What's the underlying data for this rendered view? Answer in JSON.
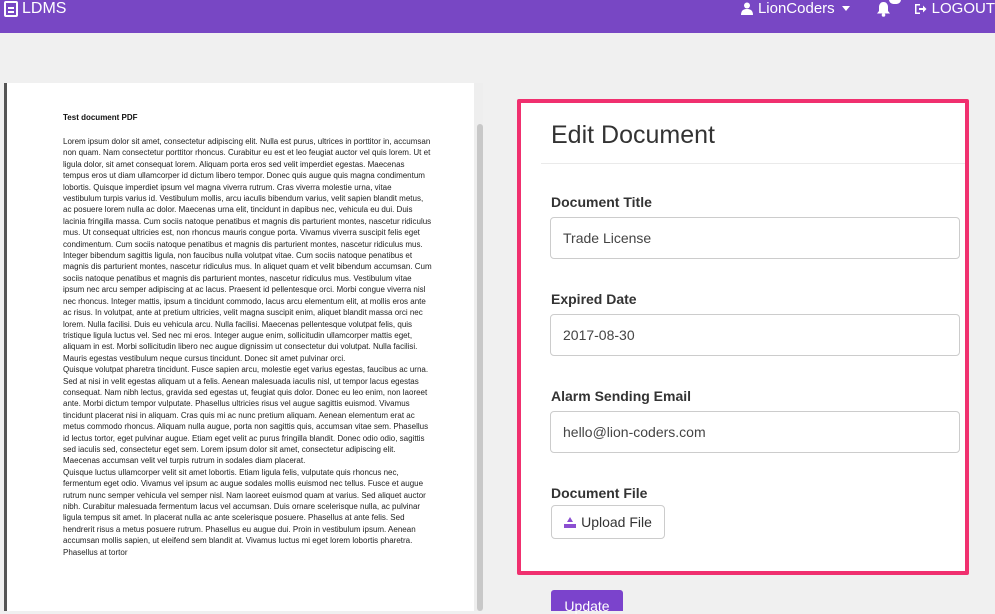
{
  "topbar": {
    "brand": "LDMS",
    "user_name": "LionCoders",
    "logout_label": "LOGOUT"
  },
  "viewer": {
    "doc_title": "Test document PDF",
    "doc_text": "Lorem ipsum dolor sit amet, consectetur adipiscing elit. Nulla est purus, ultrices in porttitor in, accumsan non quam. Nam consectetur porttitor rhoncus. Curabitur eu est et leo feugiat auctor vel quis lorem. Ut et ligula dolor, sit amet consequat lorem. Aliquam porta eros sed velit imperdiet egestas. Maecenas tempus eros ut diam ullamcorper id dictum libero tempor. Donec quis augue quis magna condimentum lobortis. Quisque imperdiet ipsum vel magna viverra rutrum. Cras viverra molestie urna, vitae vestibulum turpis varius id. Vestibulum mollis, arcu iaculis bibendum varius, velit sapien blandit metus, ac posuere lorem nulla ac dolor. Maecenas urna elit, tincidunt in dapibus nec, vehicula eu dui. Duis lacinia fringilla massa. Cum sociis natoque penatibus et magnis dis parturient montes, nascetur ridiculus mus. Ut consequat ultricies est, non rhoncus mauris congue porta. Vivamus viverra suscipit felis eget condimentum. Cum sociis natoque penatibus et magnis dis parturient montes, nascetur ridiculus mus. Integer bibendum sagittis ligula, non faucibus nulla volutpat vitae. Cum sociis natoque penatibus et magnis dis parturient montes, nascetur ridiculus mus. In aliquet quam et velit bibendum accumsan. Cum sociis natoque penatibus et magnis dis parturient montes, nascetur ridiculus mus. Vestibulum vitae ipsum nec arcu semper adipiscing at ac lacus. Praesent id pellentesque orci. Morbi congue viverra nisl nec rhoncus. Integer mattis, ipsum a tincidunt commodo, lacus arcu elementum elit, at mollis eros ante ac risus. In volutpat, ante at pretium ultricies, velit magna suscipit enim, aliquet blandit massa orci nec lorem. Nulla facilisi. Duis eu vehicula arcu. Nulla facilisi. Maecenas pellentesque volutpat felis, quis tristique ligula luctus vel. Sed nec mi eros. Integer augue enim, sollicitudin ullamcorper mattis eget, aliquam in est. Morbi sollicitudin libero nec augue dignissim ut consectetur dui volutpat. Nulla facilisi. Mauris egestas vestibulum neque cursus tincidunt. Donec sit amet pulvinar orci.\nQuisque volutpat pharetra tincidunt. Fusce sapien arcu, molestie eget varius egestas, faucibus ac urna. Sed at nisi in velit egestas aliquam ut a felis. Aenean malesuada iaculis nisl, ut tempor lacus egestas consequat. Nam nibh lectus, gravida sed egestas ut, feugiat quis dolor. Donec eu leo enim, non laoreet ante. Morbi dictum tempor vulputate. Phasellus ultricies risus vel augue sagittis euismod. Vivamus tincidunt placerat nisi in aliquam. Cras quis mi ac nunc pretium aliquam. Aenean elementum erat ac metus commodo rhoncus. Aliquam nulla augue, porta non sagittis quis, accumsan vitae sem. Phasellus id lectus tortor, eget pulvinar augue. Etiam eget velit ac purus fringilla blandit. Donec odio odio, sagittis sed iaculis sed, consectetur eget sem. Lorem ipsum dolor sit amet, consectetur adipiscing elit. Maecenas accumsan velit vel turpis rutrum in sodales diam placerat.\nQuisque luctus ullamcorper velit sit amet lobortis. Etiam ligula felis, vulputate quis rhoncus nec, fermentum eget odio. Vivamus vel ipsum ac augue sodales mollis euismod nec tellus. Fusce et augue rutrum nunc semper vehicula vel semper nisl. Nam laoreet euismod quam at varius. Sed aliquet auctor nibh. Curabitur malesuada fermentum lacus vel accumsan. Duis ornare scelerisque nulla, ac pulvinar ligula tempus sit amet. In placerat nulla ac ante scelerisque posuere. Phasellus at ante felis. Sed hendrerit risus a metus posuere rutrum. Phasellus eu augue dui. Proin in vestibulum ipsum. Aenean accumsan mollis sapien, ut eleifend sem blandit at. Vivamus luctus mi eget lorem lobortis pharetra. Phasellus at tortor"
  },
  "form": {
    "heading": "Edit Document",
    "title_label": "Document Title",
    "title_value": "Trade License",
    "expired_label": "Expired Date",
    "expired_value": "2017-08-30",
    "email_label": "Alarm Sending Email",
    "email_value": "hello@lion-coders.com",
    "file_label": "Document File",
    "upload_label": "Upload File",
    "update_label": "Update"
  },
  "colors": {
    "topbar": "#7847c4",
    "panel_border": "#f0306f",
    "accent": "#7b43cc"
  }
}
